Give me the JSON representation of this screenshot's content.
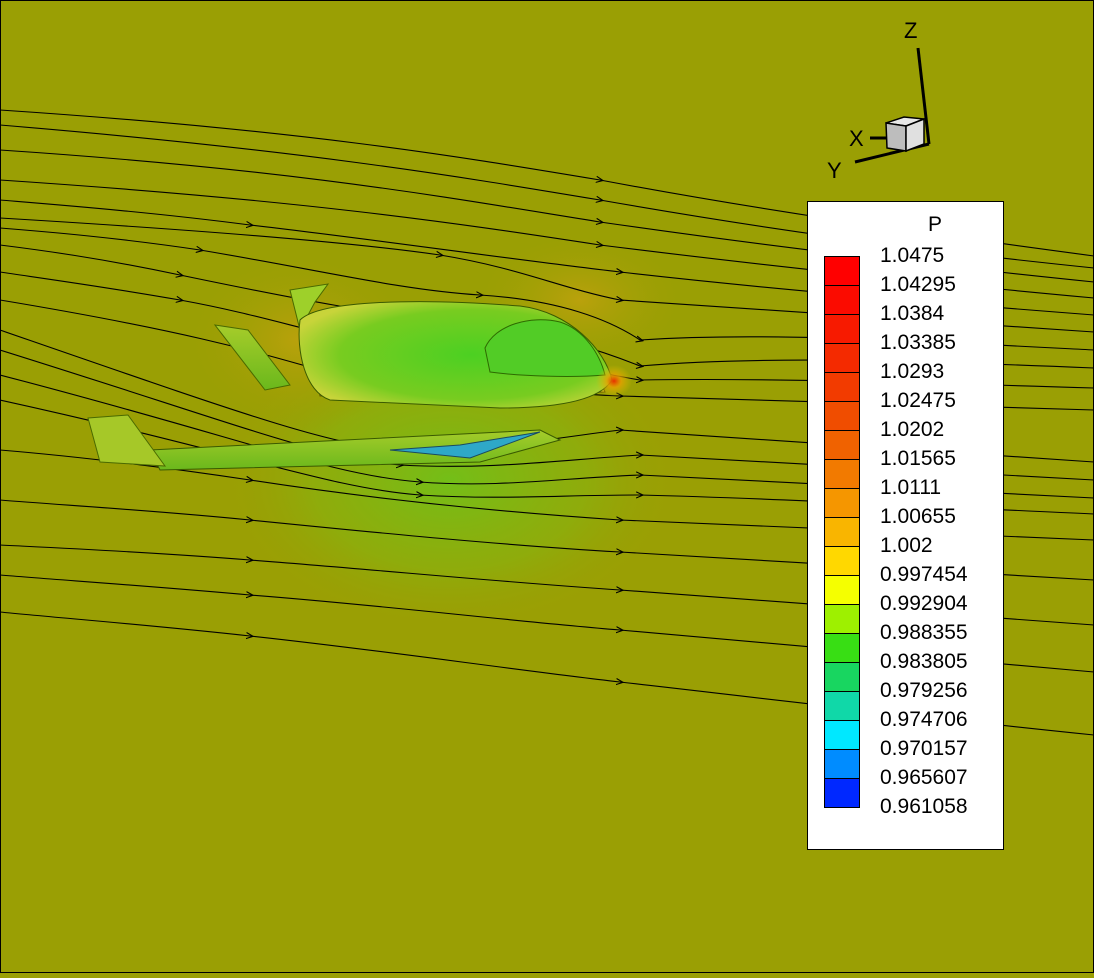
{
  "triad": {
    "z_label": "Z",
    "x_label": "X",
    "y_label": "Y"
  },
  "legend": {
    "title": "P",
    "levels": [
      {
        "label": "1.0475",
        "color": "#ff0000"
      },
      {
        "label": "1.04295",
        "color": "#fb0b00"
      },
      {
        "label": "1.0384",
        "color": "#f71a00"
      },
      {
        "label": "1.03385",
        "color": "#f42a00"
      },
      {
        "label": "1.0293",
        "color": "#f23b00"
      },
      {
        "label": "1.02475",
        "color": "#f04d00"
      },
      {
        "label": "1.0202",
        "color": "#f06200"
      },
      {
        "label": "1.01565",
        "color": "#f27a00"
      },
      {
        "label": "1.0111",
        "color": "#f59600"
      },
      {
        "label": "1.00655",
        "color": "#f9b500"
      },
      {
        "label": "1.002",
        "color": "#ffd800"
      },
      {
        "label": "0.997454",
        "color": "#f5ff00"
      },
      {
        "label": "0.992904",
        "color": "#9ef000"
      },
      {
        "label": "0.988355",
        "color": "#38de14"
      },
      {
        "label": "0.983805",
        "color": "#18d660"
      },
      {
        "label": "0.979256",
        "color": "#10d8a8"
      },
      {
        "label": "0.974706",
        "color": "#00e8ff"
      },
      {
        "label": "0.970157",
        "color": "#008cff"
      },
      {
        "label": "0.965607",
        "color": "#0028ff"
      },
      {
        "label": "0.961058",
        "color": "#0000ff"
      }
    ]
  }
}
